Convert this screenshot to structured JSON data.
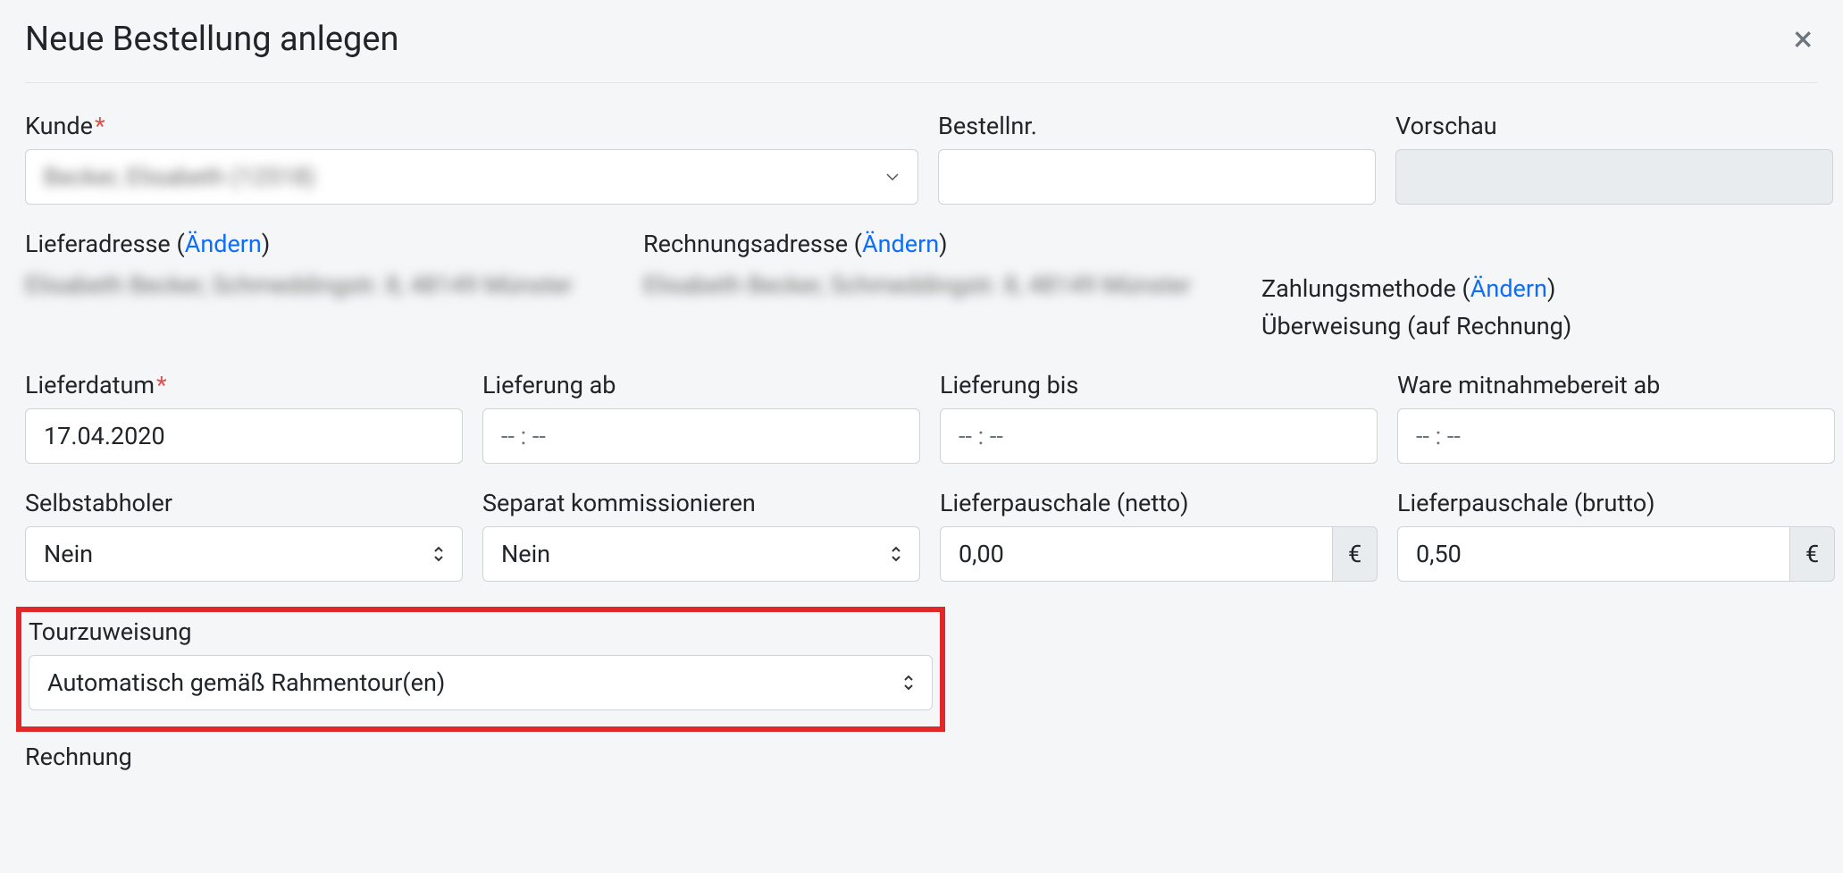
{
  "header": {
    "title": "Neue Bestellung anlegen"
  },
  "fields": {
    "kunde": {
      "label": "Kunde",
      "required": true,
      "value": "Becker, Elisabeth (12518)"
    },
    "bestellnr": {
      "label": "Bestellnr.",
      "value": ""
    },
    "vorschau": {
      "label": "Vorschau",
      "value": ""
    }
  },
  "addresses": {
    "liefer": {
      "label": "Lieferadresse",
      "change": "Ändern",
      "text": "Elisabeth Becker, Schmeddingstr. 8, 48149 Münster"
    },
    "rechn": {
      "label": "Rechnungsadresse",
      "change": "Ändern",
      "text": "Elisabeth Becker, Schmeddingstr. 8, 48149 Münster"
    }
  },
  "payment": {
    "label": "Zahlungsmethode",
    "change": "Ändern",
    "value": "Überweisung (auf Rechnung)"
  },
  "dates": {
    "lieferdatum": {
      "label": "Lieferdatum",
      "required": true,
      "value": "17.04.2020"
    },
    "lieferung_ab": {
      "label": "Lieferung ab",
      "value": "-- : --"
    },
    "lieferung_bis": {
      "label": "Lieferung bis",
      "value": "-- : --"
    },
    "ware_ab": {
      "label": "Ware mitnahmebereit ab",
      "value": "-- : --"
    }
  },
  "flags": {
    "selbstabholer": {
      "label": "Selbstabholer",
      "value": "Nein"
    },
    "sep_komm": {
      "label": "Separat kommissionieren",
      "value": "Nein"
    },
    "lp_netto": {
      "label": "Lieferpauschale (netto)",
      "value": "0,00",
      "unit": "€"
    },
    "lp_brutto": {
      "label": "Lieferpauschale (brutto)",
      "value": "0,50",
      "unit": "€"
    }
  },
  "tour": {
    "label": "Tourzuweisung",
    "value": "Automatisch gemäß Rahmentour(en)"
  },
  "section": {
    "rechnung": "Rechnung"
  }
}
